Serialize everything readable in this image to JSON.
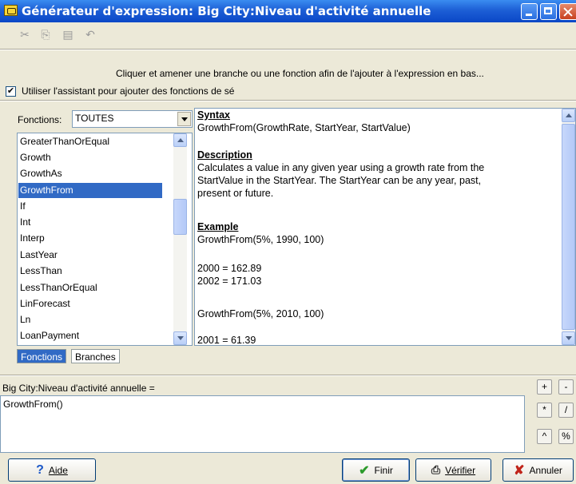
{
  "window": {
    "title": "Générateur d'expression: Big City:Niveau d'activité annuelle"
  },
  "toolbar": {
    "icons": [
      "cut-icon",
      "copy-icon",
      "paste-icon",
      "undo-icon"
    ]
  },
  "instruction": "Cliquer et amener une branche ou une fonction afin de l'ajouter à l'expression en bas...",
  "assistant": {
    "checked": true,
    "label": "Utiliser l'assistant pour ajouter des fonctions de sé"
  },
  "functions": {
    "label": "Fonctions:",
    "filter_value": "TOUTES",
    "items": [
      "GreaterThanOrEqual",
      "Growth",
      "GrowthAs",
      "GrowthFrom",
      "If",
      "Int",
      "Interp",
      "LastYear",
      "LessThan",
      "LessThanOrEqual",
      "LinForecast",
      "Ln",
      "LoanPayment"
    ],
    "selected": "GrowthFrom"
  },
  "help": {
    "syntax_heading": "Syntax",
    "syntax": "GrowthFrom(GrowthRate, StartYear, StartValue)",
    "description_heading": "Description",
    "description_lines": [
      "Calculates a value in any given year using a growth rate from the",
      "StartValue in the StartYear.  The StartYear can be any year, past,",
      "present or future."
    ],
    "example_heading": "Example",
    "example_lines": [
      "GrowthFrom(5%, 1990, 100)",
      "",
      "2000 = 162.89",
      "2002 = 171.03",
      "",
      "GrowthFrom(5%, 2010, 100)",
      "",
      "2001 = 61.39"
    ]
  },
  "tabs": [
    "Fonctions",
    "Branches"
  ],
  "expression": {
    "label": "Big City:Niveau d'activité annuelle =",
    "value": "GrowthFrom()"
  },
  "operators": [
    "+",
    "-",
    "*",
    "/",
    "^",
    "%"
  ],
  "buttons": {
    "help": "Aide",
    "finish": "Finir",
    "verify": "Vérifier",
    "cancel": "Annuler"
  }
}
